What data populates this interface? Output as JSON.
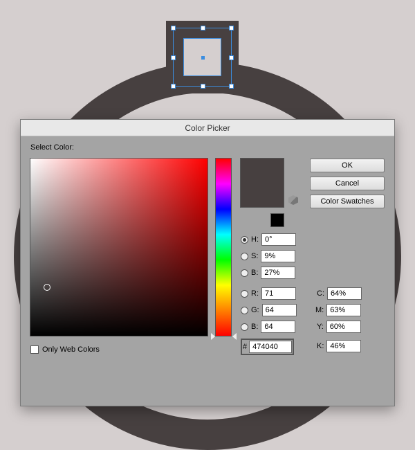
{
  "dialog": {
    "title": "Color Picker",
    "selectLabel": "Select Color:",
    "buttons": {
      "ok": "OK",
      "cancel": "Cancel",
      "swatches": "Color Swatches"
    },
    "hsb": {
      "hLabel": "H:",
      "sLabel": "S:",
      "bLabel": "B:",
      "h": "0°",
      "s": "9%",
      "b": "27%"
    },
    "rgb": {
      "rLabel": "R:",
      "gLabel": "G:",
      "bLabel": "B:",
      "r": "71",
      "g": "64",
      "b": "64"
    },
    "cmyk": {
      "cLabel": "C:",
      "mLabel": "M:",
      "yLabel": "Y:",
      "kLabel": "K:",
      "c": "64%",
      "m": "63%",
      "y": "60%",
      "k": "46%"
    },
    "hexLabel": "#",
    "hex": "474040",
    "webOnly": "Only Web Colors",
    "previewColor": "#474040"
  }
}
